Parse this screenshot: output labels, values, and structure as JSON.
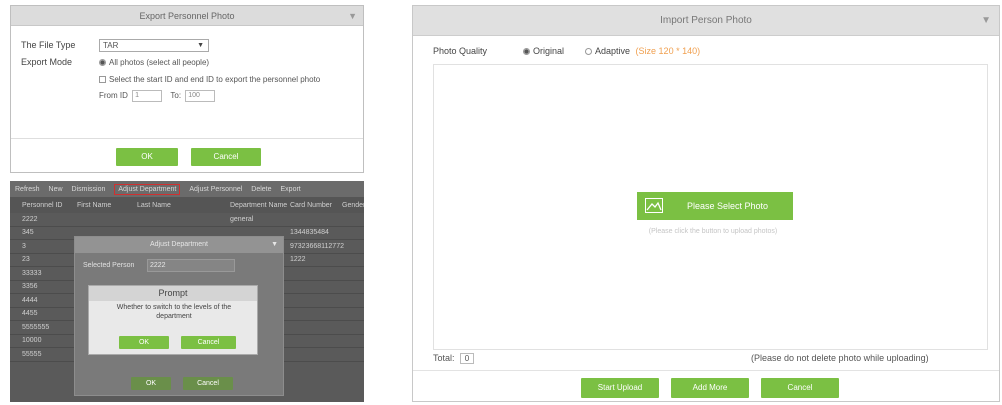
{
  "export_dialog": {
    "title": "Export Personnel Photo",
    "file_type_label": "The File Type",
    "file_type_value": "TAR",
    "export_mode_label": "Export Mode",
    "option_all": "All photos (select all people)",
    "option_range": "Select the start ID and end ID to export the personnel photo",
    "from_label": "From ID",
    "from_value": "1",
    "to_label": "To",
    "to_value": "100",
    "ok_label": "OK",
    "cancel_label": "Cancel"
  },
  "dept_screen": {
    "toolbar": [
      "Refresh",
      "New",
      "Dismission",
      "Adjust Department",
      "Adjust Personnel",
      "Delete",
      "Export"
    ],
    "columns": [
      "",
      "Personnel ID",
      "First Name",
      "Last Name",
      "Department Name",
      "Card Number",
      "Gender"
    ],
    "rows": [
      [
        "",
        "2222",
        "",
        "",
        "general",
        "",
        ""
      ],
      [
        "",
        "345",
        "",
        "",
        "",
        "1344835484",
        ""
      ],
      [
        "",
        "3",
        "",
        "",
        "",
        "97323668112772",
        ""
      ],
      [
        "",
        "23",
        "",
        "",
        "",
        "1222",
        ""
      ],
      [
        "",
        "33333",
        "",
        "",
        "",
        "",
        ""
      ],
      [
        "",
        "3356",
        "",
        "",
        "",
        "",
        ""
      ],
      [
        "",
        "4444",
        "",
        "",
        "",
        "",
        ""
      ],
      [
        "",
        "4455",
        "",
        "",
        "",
        "",
        ""
      ],
      [
        "",
        "5555555",
        "",
        "",
        "",
        "",
        ""
      ],
      [
        "",
        "10000",
        "",
        "",
        "",
        "",
        ""
      ],
      [
        "",
        "55555",
        "",
        "",
        "",
        "",
        ""
      ]
    ]
  },
  "adjust_dialog": {
    "title": "Adjust Department",
    "selected_person_label": "Selected Person",
    "selected_person_value": "2222",
    "ok_label": "OK",
    "cancel_label": "Cancel"
  },
  "prompt": {
    "title": "Prompt",
    "message": "Whether to switch to the levels of the department",
    "ok_label": "OK",
    "cancel_label": "Cancel"
  },
  "import_dialog": {
    "title": "Import Person Photo",
    "photo_quality_label": "Photo Quality",
    "original_label": "Original",
    "adaptive_label": "Adaptive",
    "adaptive_size": "(Size 120 * 140)",
    "select_photo_label": "Please Select Photo",
    "hint": "(Please click the button to upload photos)",
    "total_label": "Total:",
    "total_value": "0",
    "warning": "(Please do not delete photo while uploading)",
    "start_upload_label": "Start Upload",
    "add_more_label": "Add More",
    "cancel_label": "Cancel"
  },
  "colors": {
    "accent_green": "#7bc043",
    "adaptive_orange": "#f0a050",
    "highlight_red": "#d03030"
  }
}
